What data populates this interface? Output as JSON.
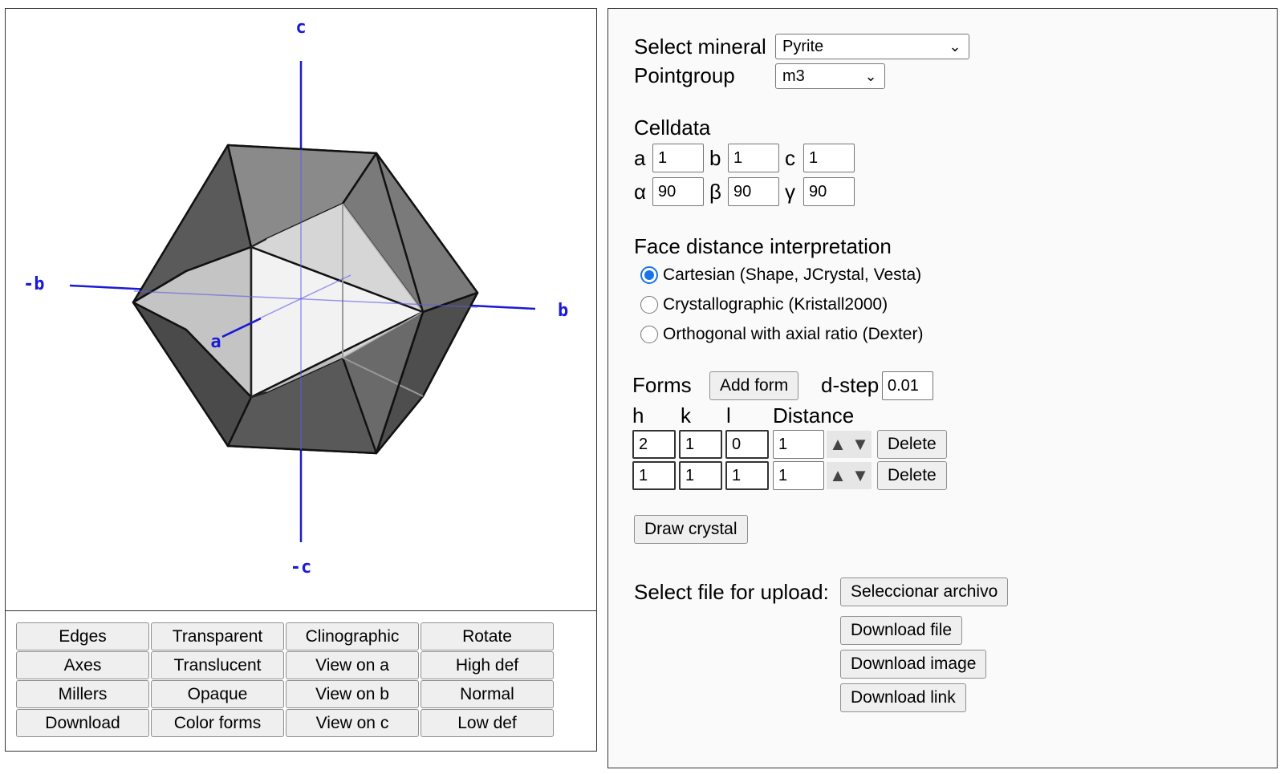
{
  "viewer": {
    "axis_labels": {
      "c": "c",
      "neg_c": "-c",
      "b": "b",
      "neg_b": "-b",
      "a": "a"
    },
    "axis_color": "#1a1ad6",
    "controls": [
      [
        "Edges",
        "Transparent",
        "Clinographic",
        "Rotate"
      ],
      [
        "Axes",
        "Translucent",
        "View on a",
        "High def"
      ],
      [
        "Millers",
        "Opaque",
        "View on b",
        "Normal"
      ],
      [
        "Download",
        "Color forms",
        "View on c",
        "Low def"
      ]
    ]
  },
  "mineral": {
    "label": "Select mineral",
    "selected": "Pyrite"
  },
  "pointgroup": {
    "label": "Pointgroup",
    "selected": "m3"
  },
  "celldata": {
    "title": "Celldata",
    "a_label": "a",
    "a": "1",
    "b_label": "b",
    "b": "1",
    "c_label": "c",
    "c": "1",
    "alpha_label": "α",
    "alpha": "90",
    "beta_label": "β",
    "beta": "90",
    "gamma_label": "γ",
    "gamma": "90"
  },
  "interpretation": {
    "title": "Face distance interpretation",
    "options": [
      {
        "label": "Cartesian (Shape, JCrystal, Vesta)",
        "checked": true
      },
      {
        "label": "Crystallographic (Kristall2000)",
        "checked": false
      },
      {
        "label": "Orthogonal with axial ratio (Dexter)",
        "checked": false
      }
    ]
  },
  "forms": {
    "title": "Forms",
    "add_label": "Add form",
    "dstep_label": "d-step",
    "dstep": "0.01",
    "headers": {
      "h": "h",
      "k": "k",
      "l": "l",
      "distance": "Distance"
    },
    "rows": [
      {
        "h": "2",
        "k": "1",
        "l": "0",
        "distance": "1"
      },
      {
        "h": "1",
        "k": "1",
        "l": "1",
        "distance": "1"
      }
    ],
    "up_glyph": "▲",
    "down_glyph": "▼",
    "delete_label": "Delete"
  },
  "draw_label": "Draw crystal",
  "upload": {
    "label": "Select file for upload:",
    "choose_label": "Seleccionar archivo",
    "download_file": "Download file",
    "download_image": "Download image",
    "download_link": "Download link"
  },
  "chevron_glyph": "⌄",
  "accent": "#1a73e8"
}
